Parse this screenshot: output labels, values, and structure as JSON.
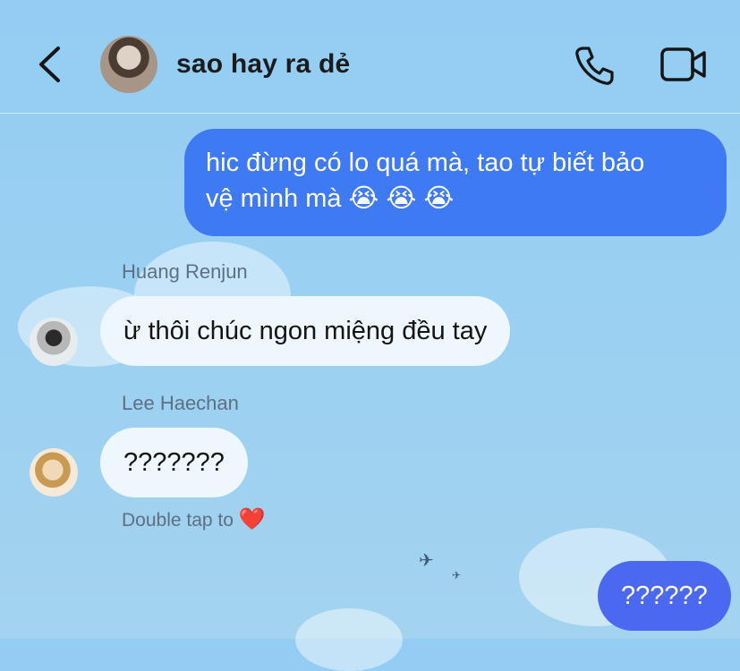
{
  "header": {
    "title": "sao hay ra dẻ",
    "icons": {
      "back": "chevron-left-icon",
      "call": "phone-icon",
      "video": "video-camera-icon"
    }
  },
  "messages": [
    {
      "direction": "outgoing",
      "text_line1": "hic đừng có lo quá mà, tao tự biết bảo",
      "text_line2": "vệ mình mà 😭 😭 😭"
    },
    {
      "direction": "incoming",
      "sender": "Huang Renjun",
      "text": "ừ thôi chúc ngon miệng đều tay"
    },
    {
      "direction": "incoming",
      "sender": "Lee Haechan",
      "text": "???????",
      "hint": "Double tap to",
      "hint_icon": "heart-icon",
      "hint_emoji": "❤️"
    },
    {
      "direction": "outgoing",
      "text": "??????"
    }
  ],
  "colors": {
    "outgoing_bubble": "#3d7af3",
    "outgoing_bubble_last": "#4b68f1",
    "incoming_bubble": "#eef7fd",
    "background": "#93cdf3"
  }
}
